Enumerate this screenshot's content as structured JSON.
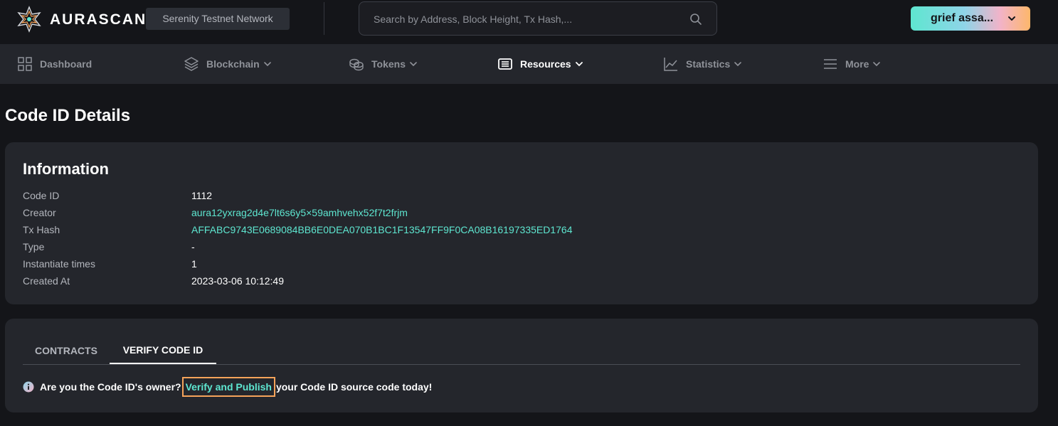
{
  "header": {
    "brand": "AURASCAN",
    "network": "Serenity Testnet Network",
    "search_placeholder": "Search by Address, Block Height, Tx Hash,...",
    "wallet_label": "grief assa..."
  },
  "nav": {
    "items": [
      {
        "label": "Dashboard",
        "icon": "grid-icon",
        "has_dropdown": false,
        "active": false
      },
      {
        "label": "Blockchain",
        "icon": "layers-icon",
        "has_dropdown": true,
        "active": false
      },
      {
        "label": "Tokens",
        "icon": "coins-icon",
        "has_dropdown": true,
        "active": false
      },
      {
        "label": "Resources",
        "icon": "newspaper-icon",
        "has_dropdown": true,
        "active": true
      },
      {
        "label": "Statistics",
        "icon": "line-chart-icon",
        "has_dropdown": true,
        "active": false
      },
      {
        "label": "More",
        "icon": "menu-icon",
        "has_dropdown": true,
        "active": false
      }
    ]
  },
  "page": {
    "title": "Code ID Details"
  },
  "information": {
    "title": "Information",
    "rows": [
      {
        "label": "Code ID",
        "value": "1112"
      },
      {
        "label": "Creator",
        "value": "aura12yxrag2d4e7lt6s6y5×59amhvehx52f7t2frjm"
      },
      {
        "label": "Tx Hash",
        "value": "AFFABC9743E0689084BB6E0DEA070B1BC1F13547FF9F0CA08B16197335ED1764"
      },
      {
        "label": "Type",
        "value": "-"
      },
      {
        "label": "Instantiate times",
        "value": "1"
      },
      {
        "label": "Created At",
        "value": "2023-03-06 10:12:49"
      }
    ]
  },
  "tabs": {
    "items": [
      {
        "label": "CONTRACTS",
        "active": false
      },
      {
        "label": "VERIFY CODE ID",
        "active": true
      }
    ],
    "verify": {
      "prefix": "Are you the Code ID's owner?",
      "link": "Verify and Publish",
      "suffix": "your Code ID source code today!"
    }
  },
  "colors": {
    "background": "#141519",
    "surface": "#24262c",
    "accent": "#5ee6d0",
    "highlight_border": "#f5a35a",
    "muted_text": "#8f9299"
  }
}
